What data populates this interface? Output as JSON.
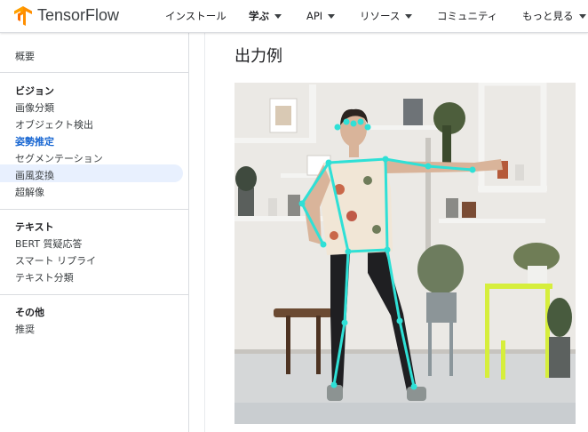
{
  "header": {
    "brand": "TensorFlow",
    "nav": [
      {
        "label": "インストール",
        "dropdown": false
      },
      {
        "label": "学ぶ",
        "dropdown": true,
        "active": true
      },
      {
        "label": "API",
        "dropdown": true
      },
      {
        "label": "リソース",
        "dropdown": true
      },
      {
        "label": "コミュニティ",
        "dropdown": false
      },
      {
        "label": "もっと見る",
        "dropdown": true
      }
    ]
  },
  "sidebar": {
    "overview": "概要",
    "sections": [
      {
        "title": "ビジョン",
        "items": [
          "画像分類",
          "オブジェクト検出",
          "姿勢推定",
          "セグメンテーション",
          "画風変換",
          "超解像"
        ]
      },
      {
        "title": "テキスト",
        "items": [
          "BERT 質疑応答",
          "スマート リプライ",
          "テキスト分類"
        ]
      },
      {
        "title": "その他",
        "items": [
          "推奨"
        ]
      }
    ],
    "active_item": "姿勢推定"
  },
  "main": {
    "title": "出力例"
  },
  "colors": {
    "accent": "#1967d2",
    "active_bg": "#e8f0fe",
    "skeleton": "#2fe0d6",
    "logo": "#ff8f00"
  }
}
